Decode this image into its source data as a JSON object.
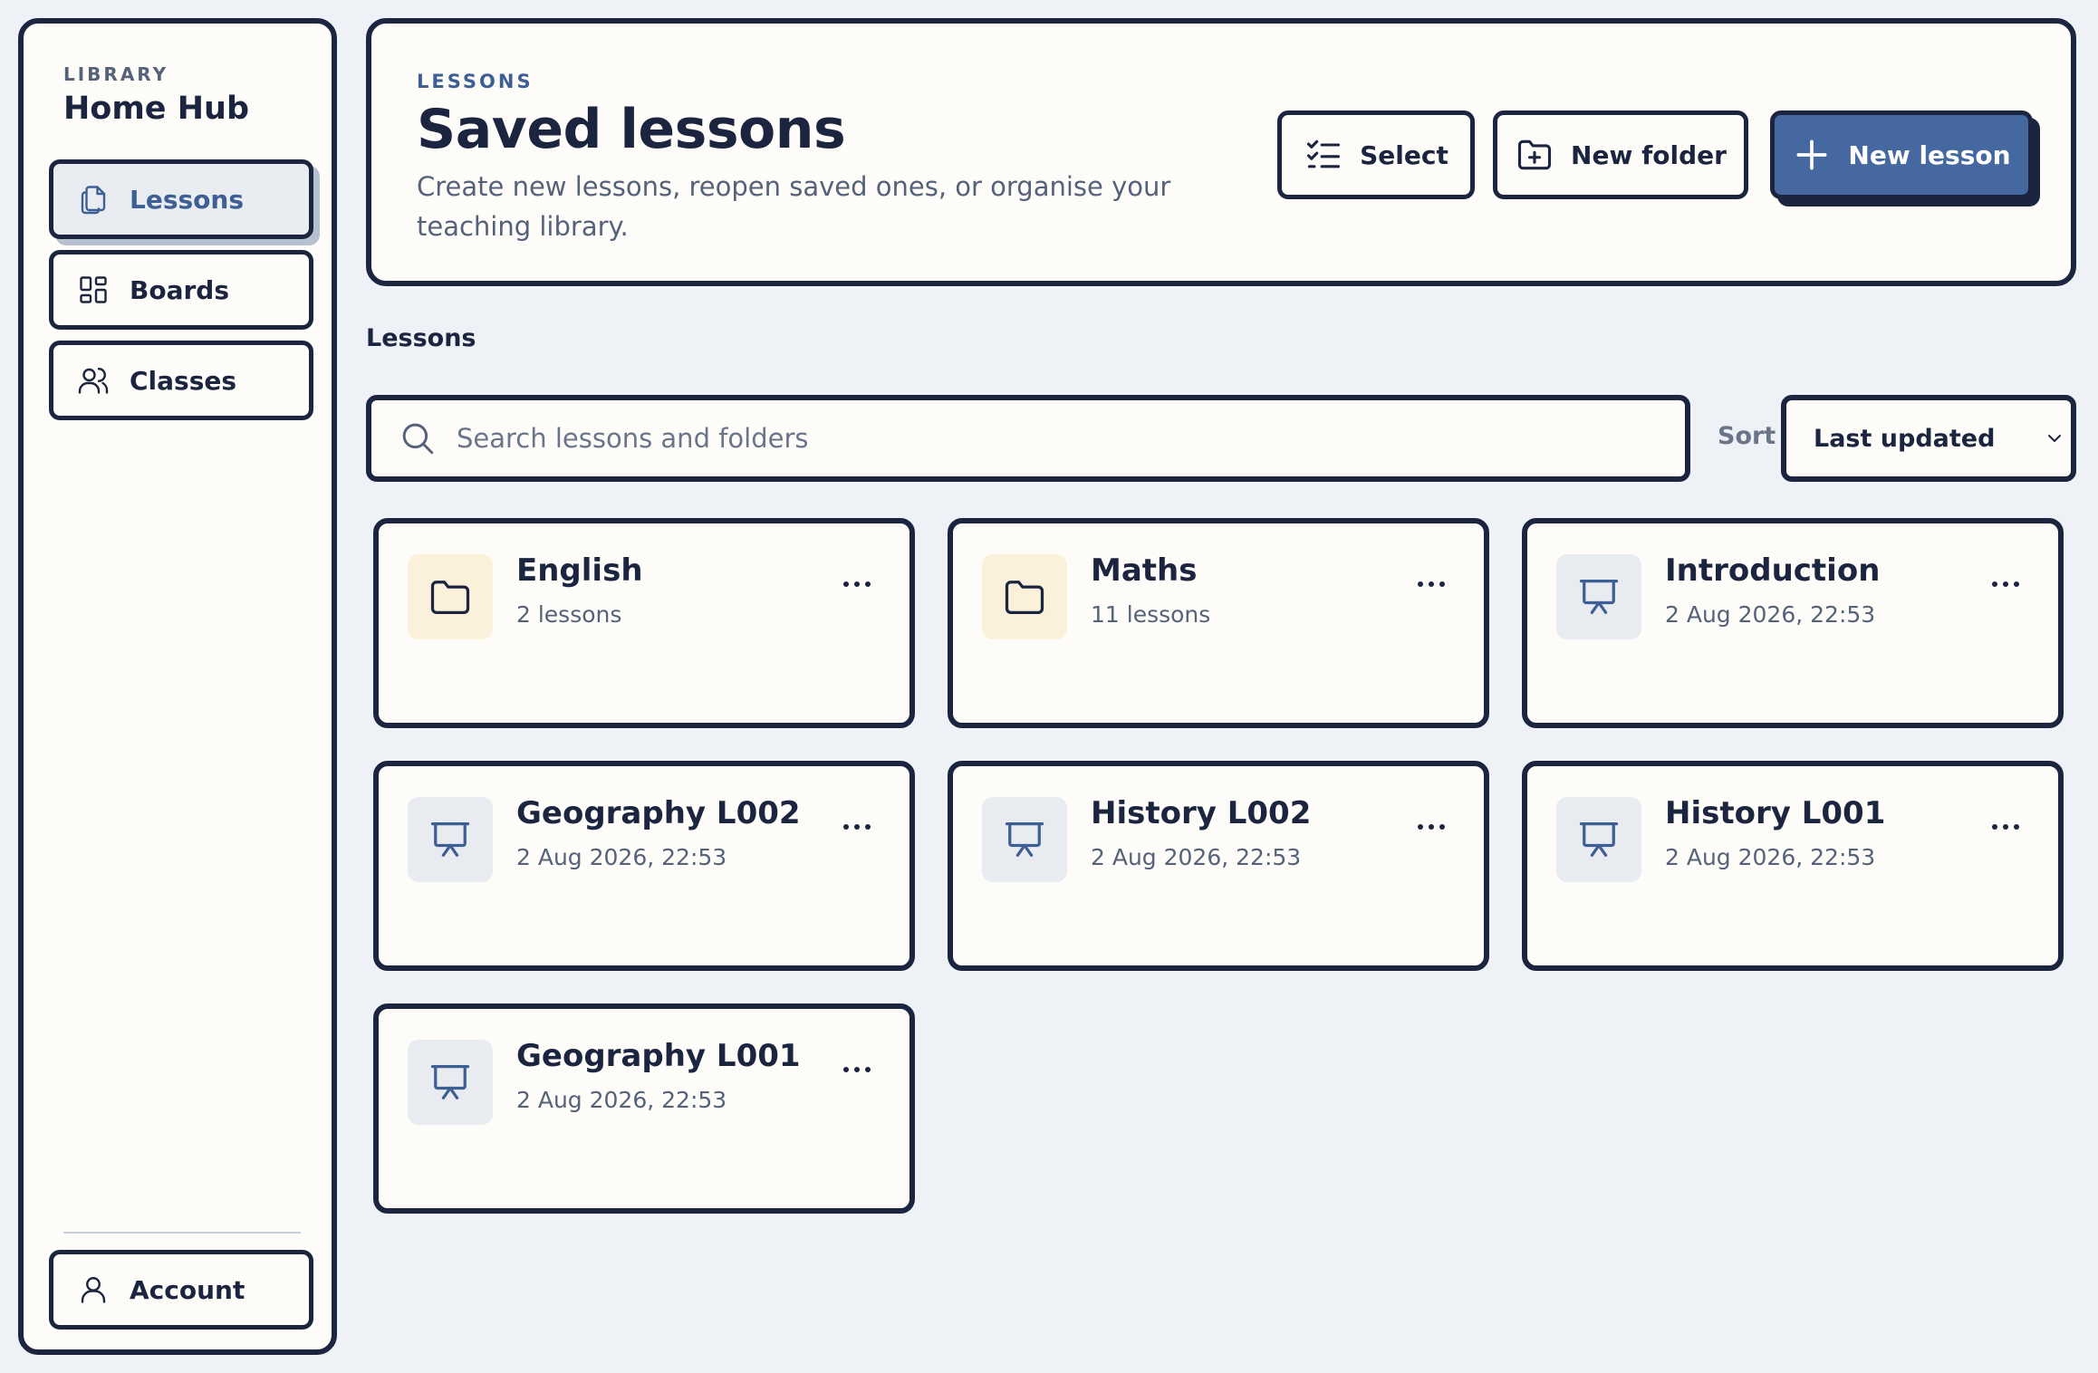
{
  "sidebar": {
    "eyebrow": "LIBRARY",
    "title": "Home Hub",
    "nav": [
      {
        "label": "Lessons",
        "icon": "document-copy-icon",
        "active": true
      },
      {
        "label": "Boards",
        "icon": "grid-icon",
        "active": false
      },
      {
        "label": "Classes",
        "icon": "users-icon",
        "active": false
      }
    ],
    "account": {
      "label": "Account",
      "icon": "user-icon"
    }
  },
  "header": {
    "eyebrow": "LESSONS",
    "title": "Saved lessons",
    "description": "Create new lessons, reopen saved ones, or organise your teaching library.",
    "buttons": {
      "select": "Select",
      "new_folder": "New folder",
      "new_lesson": "New lesson"
    }
  },
  "section_label": "Lessons",
  "search": {
    "placeholder": "Search lessons and folders",
    "value": ""
  },
  "sort": {
    "label": "Sort",
    "selected": "Last updated"
  },
  "items": [
    {
      "type": "folder",
      "title": "English",
      "subtitle": "2 lessons",
      "icon": "folder-icon"
    },
    {
      "type": "folder",
      "title": "Maths",
      "subtitle": "11 lessons",
      "icon": "folder-icon"
    },
    {
      "type": "lesson",
      "title": "Introduction",
      "subtitle": "2 Aug 2026, 22:53",
      "icon": "presentation-icon"
    },
    {
      "type": "lesson",
      "title": "Geography L002",
      "subtitle": "2 Aug 2026, 22:53",
      "icon": "presentation-icon"
    },
    {
      "type": "lesson",
      "title": "History L002",
      "subtitle": "2 Aug 2026, 22:53",
      "icon": "presentation-icon"
    },
    {
      "type": "lesson",
      "title": "History L001",
      "subtitle": "2 Aug 2026, 22:53",
      "icon": "presentation-icon"
    },
    {
      "type": "lesson",
      "title": "Geography L001",
      "subtitle": "2 Aug 2026, 22:53",
      "icon": "presentation-icon"
    }
  ],
  "colors": {
    "background": "#eef1f6",
    "surface": "#fdfcf8",
    "ink": "#1c2540",
    "accent": "#44689f",
    "muted": "#55627a",
    "folder_tile": "#fbf0d9",
    "lesson_tile": "#e8ecf1"
  }
}
